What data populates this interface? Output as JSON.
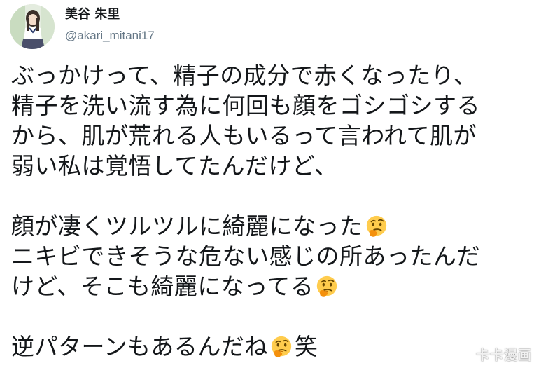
{
  "profile": {
    "display_name": "美谷 朱里",
    "handle": "@akari_mitani17",
    "avatar_icon": "profile-photo-avatar"
  },
  "tweet": {
    "lines": [
      "ぶっかけって、精子の成分で赤くなったり、",
      "精子を洗い流す為に何回も顔をゴシゴシする",
      "から、肌が荒れる人もいるって言われて肌が",
      "弱い私は覚悟してたんだけど、",
      "",
      "顔が凄くツルツルに綺麗になった",
      "ニキビできそうな危ない感じの所あったんだ",
      "けど、そこも綺麗になってる",
      "",
      "逆パターンもあるんだね",
      "笑"
    ],
    "emoji_icon": "thinking-face-emoji"
  },
  "watermark": {
    "text": "卡卡漫画"
  },
  "colors": {
    "text": "#14171a",
    "handle": "#657786",
    "emoji_face": "#ffcc4d"
  }
}
